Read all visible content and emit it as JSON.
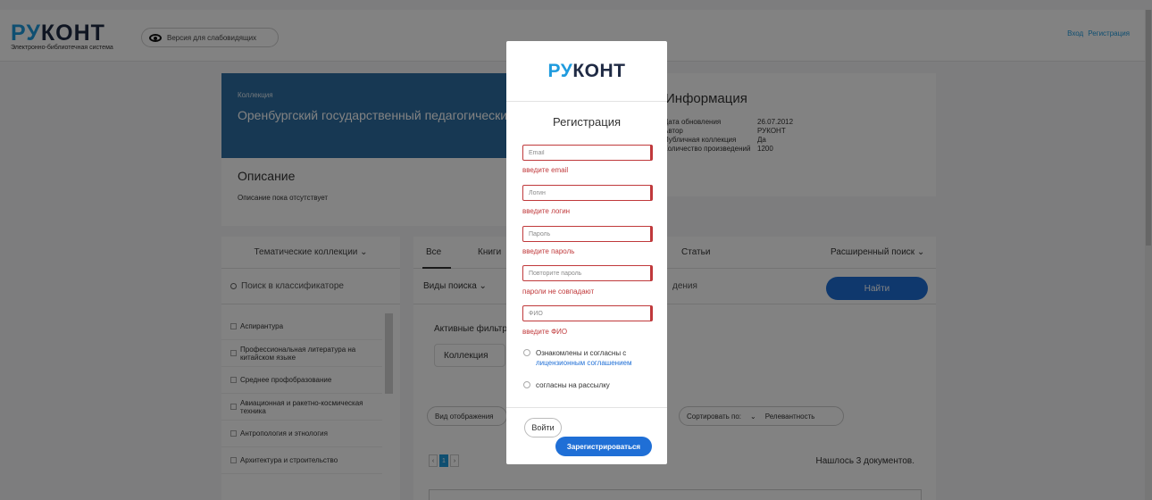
{
  "header": {
    "logo_ru": "РУ",
    "logo_kont": "КОНТ",
    "logo_subtitle": "Электронно-библиотечная система",
    "accessibility_label": "Версия для слабовидящих",
    "login_link": "Вход",
    "register_link": "Регистрация"
  },
  "collection": {
    "label": "Коллекция",
    "title": "Оренбургский государственный педагогический университет"
  },
  "info": {
    "heading": "Информация",
    "rows": [
      {
        "key": "Дата обновления",
        "value": "26.07.2012"
      },
      {
        "key": "Автор",
        "value": "РУКОНТ"
      },
      {
        "key": "Публичная коллекция",
        "value": "Да"
      },
      {
        "key": "Количество произведений",
        "value": "1200"
      }
    ]
  },
  "description": {
    "heading": "Описание",
    "text": "Описание пока отсутствует"
  },
  "left_panel": {
    "thematic_select": "Тематические коллекции ⌄",
    "classifier_search": "Поиск в классификаторе",
    "categories": [
      "Аспирантура",
      "Профессиональная литература на китайском языке",
      "Среднее профобразование",
      "Авиационная и ракетно-космическая техника",
      "Антропология и этнология",
      "Архитектура и строительство"
    ]
  },
  "right_panel": {
    "tabs": [
      "Все",
      "Книги",
      "Статьи",
      "Расширенный поиск ⌄"
    ],
    "search_types": "Виды поиска ⌄",
    "search_placeholder_tail": "дения",
    "find_button": "Найти",
    "active_filters": "Активные фильтры",
    "collection_chip": "Коллекция",
    "view_mode": "Вид отображения",
    "sort_label": "Сортировать по:",
    "sort_value": "Релевантность",
    "page_current": "1",
    "found_text": "Нашлось 3 документов."
  },
  "modal": {
    "logo_ru": "РУ",
    "logo_kont": "КОНТ",
    "title": "Регистрация",
    "email_placeholder": "Email",
    "email_error": "введите email",
    "login_placeholder": "Логин",
    "login_error": "введите логин",
    "password_placeholder": "Пароль",
    "password_error": "введите пароль",
    "password_repeat_placeholder": "Повторите пароль",
    "password_repeat_error": "пароли не совпадают",
    "fio_placeholder": "ФИО",
    "fio_error": "введите ФИО",
    "agree_text": "Ознакомлены и согласны с",
    "agree_link": "лицензионным соглашением",
    "newsletter_text": "согласны на рассылку",
    "login_button": "Войти",
    "register_button": "Зарегистрироваться"
  },
  "colors": {
    "brand_blue": "#1f9bde",
    "button_blue": "#1f6fd6",
    "error_red": "#c0393b",
    "banner_blue": "#2d6fa3"
  }
}
